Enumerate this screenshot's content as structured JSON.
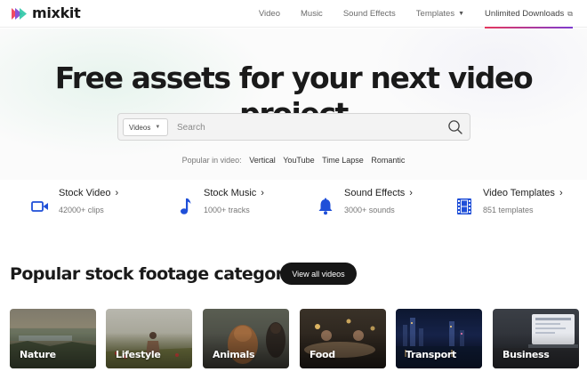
{
  "header": {
    "logo_text": "mixkit",
    "nav": [
      {
        "label": "Video"
      },
      {
        "label": "Music"
      },
      {
        "label": "Sound Effects"
      },
      {
        "label": "Templates",
        "has_caret": true
      },
      {
        "label": "Unlimited Downloads",
        "external": true
      }
    ]
  },
  "hero": {
    "title": "Free assets for your next video project",
    "search": {
      "select_value": "Videos",
      "placeholder": "Search"
    },
    "popular": {
      "label": "Popular in video:",
      "tags": [
        "Vertical",
        "YouTube",
        "Time Lapse",
        "Romantic"
      ]
    }
  },
  "categories": [
    {
      "title": "Stock Video",
      "subtitle": "42000+ clips",
      "icon": "video-camera-icon"
    },
    {
      "title": "Stock Music",
      "subtitle": "1000+ tracks",
      "icon": "music-note-icon"
    },
    {
      "title": "Sound Effects",
      "subtitle": "3000+ sounds",
      "icon": "bell-icon"
    },
    {
      "title": "Video Templates",
      "subtitle": "851 templates",
      "icon": "film-strip-icon"
    }
  ],
  "footage": {
    "title": "Popular stock footage categories",
    "view_all_label": "View all videos",
    "tiles": [
      {
        "label": "Nature"
      },
      {
        "label": "Lifestyle"
      },
      {
        "label": "Animals"
      },
      {
        "label": "Food"
      },
      {
        "label": "Transport"
      },
      {
        "label": "Business"
      }
    ]
  },
  "colors": {
    "accent_blue": "#1f4fd8",
    "button_dark": "#161616",
    "underline_start": "#e6375c",
    "underline_end": "#7e3bd0"
  }
}
